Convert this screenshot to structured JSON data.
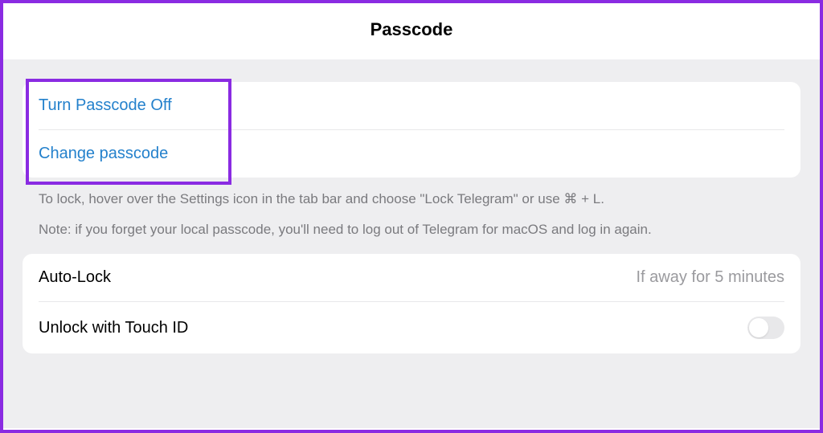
{
  "header": {
    "title": "Passcode"
  },
  "actions": {
    "turn_off_label": "Turn Passcode Off",
    "change_label": "Change passcode"
  },
  "footer": {
    "line1": "To lock, hover over the Settings icon in the tab bar and choose \"Lock Telegram\" or use ⌘ + L.",
    "line2": "Note: if you forget your local passcode, you'll need to log out of Telegram for macOS and log in again."
  },
  "settings": {
    "autolock_label": "Auto-Lock",
    "autolock_value": "If away for 5 minutes",
    "touchid_label": "Unlock with Touch ID",
    "touchid_enabled": false
  }
}
